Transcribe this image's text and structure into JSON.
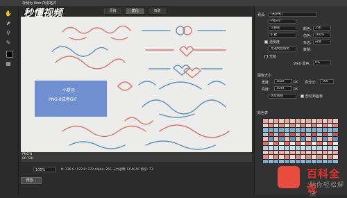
{
  "window": {
    "title": "存储为 Web 所用格式"
  },
  "logo": {
    "text": "秒懂视频"
  },
  "tabs": [
    {
      "label": "原稿"
    },
    {
      "label": "优化"
    },
    {
      "label": "双联"
    }
  ],
  "tip": {
    "title": "小提示：",
    "body": "PNG-8或者GIF"
  },
  "canvas_info": {
    "format": "PNG-8",
    "size": "80.72K"
  },
  "status": {
    "zoom": "100%",
    "readout": "R: 236   G: 172   B: 172   Alpha: 255   十六进制: ECACAC   索引: 73"
  },
  "buttons": {
    "preview": "预览...",
    "save": "存储",
    "cancel": "取消",
    "done": "完成"
  },
  "panel": {
    "preset_label": "预设:",
    "preset_value": "[未命名]",
    "format_value": "PNG-8",
    "reduction_value": "可感知",
    "colors_label": "颜色:",
    "colors_value": "256",
    "dither_algo": "扩散",
    "dither_label": "仿色:",
    "dither_value": "100%",
    "transparency_label": "透明度",
    "matte_label": "杂边:",
    "matte_value": "白色",
    "trans_dither": "无透明度仿色",
    "amount_label": "数量:",
    "interlaced_label": "交错",
    "web_snap_label": "Web 靠色:",
    "web_snap_value": "0%",
    "image_size_label": "图像大小",
    "width_label": "宽度:",
    "width_value": "1020",
    "height_label": "高度:",
    "height_value": "1544",
    "percent_label": "百分比:",
    "percent_value": "100",
    "quality_value": "优化两侧",
    "unit_px": "px",
    "anim_label": "剪切到画板",
    "color_table_label": "颜色表"
  },
  "watermark": {
    "brand": "百科全说",
    "slogan": "助你轻松解决"
  },
  "colors": {
    "accent": "#6f8fd0",
    "brand": "#e5312a",
    "ornament_red": "#d9776d",
    "ornament_blue": "#5e95b8"
  }
}
